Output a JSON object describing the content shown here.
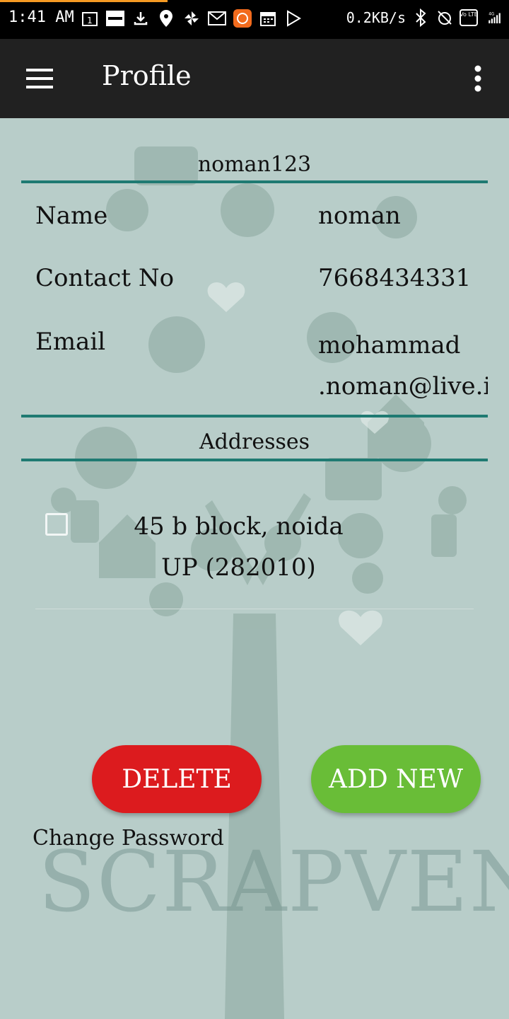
{
  "status_bar": {
    "time": "1:41 AM",
    "net_speed": "0.2KB/s",
    "network": "4G",
    "volte": "Vo LTE",
    "icons": [
      "calendar-1-icon",
      "zomato-icon",
      "download-icon",
      "swiggy-icon",
      "pinwheel-icon",
      "gmail-icon",
      "app-orange-icon",
      "calendar-icon",
      "play-store-icon",
      "bluetooth-icon",
      "alarm-off-icon",
      "volte-icon",
      "signal-icon"
    ]
  },
  "app_bar": {
    "title": "Profile",
    "menu_icon": "hamburger-menu-icon",
    "overflow_icon": "overflow-menu-icon"
  },
  "profile": {
    "username": "noman123",
    "name_label": "Name",
    "name_value": "noman",
    "contact_label": "Contact No",
    "contact_value": "7668434331",
    "email_label": "Email",
    "email_line1": "mohammad",
    "email_line2": ".noman@live.i"
  },
  "addresses": {
    "title": "Addresses",
    "items": [
      {
        "line1": "45 b block, noida",
        "line2": "UP (282010)",
        "checked": false
      }
    ]
  },
  "actions": {
    "delete_label": "DELETE",
    "add_label": "ADD NEW",
    "change_password": "Change Password"
  },
  "brand": {
    "text": "SCRAPVEND"
  },
  "colors": {
    "teal": "#1f7a72",
    "delete": "#dc1b1e",
    "add": "#69bd37",
    "app_bar": "#212121",
    "background": "#b8cdc9"
  }
}
